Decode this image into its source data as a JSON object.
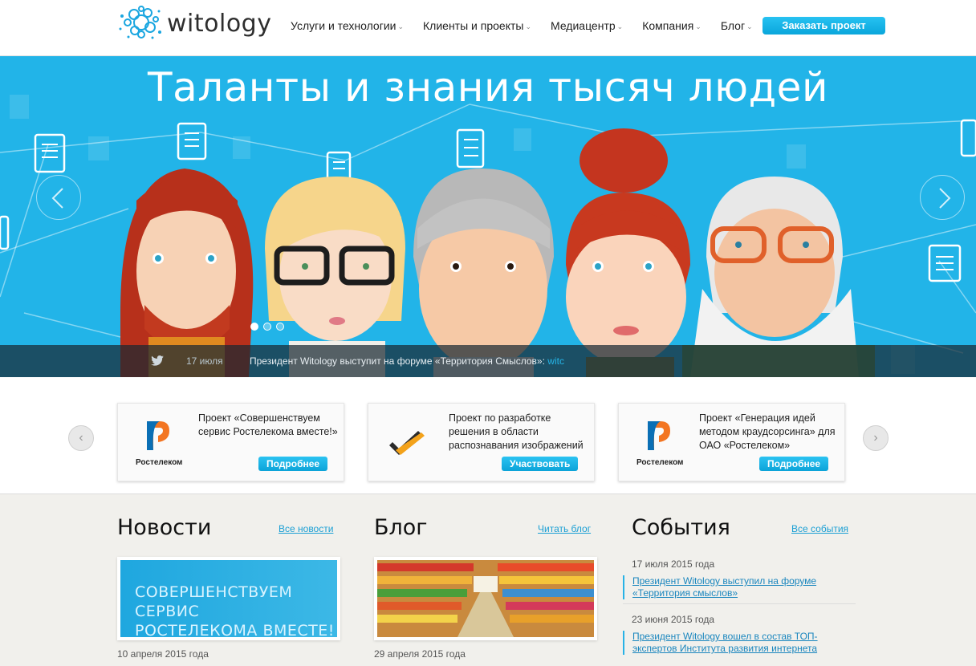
{
  "header": {
    "logo_text": "witology",
    "nav": [
      {
        "label": "Услуги и технологии"
      },
      {
        "label": "Клиенты и проекты"
      },
      {
        "label": "Медиацентр"
      },
      {
        "label": "Компания"
      },
      {
        "label": "Блог"
      }
    ],
    "order_button": "Заказать проект"
  },
  "hero": {
    "title": "Таланты и знания тысяч людей",
    "ticker_date": "17 июля",
    "ticker_text": "Президент Witology выступит на форуме «Территория Смыслов»:",
    "ticker_link": "witc",
    "slides": 3,
    "active_slide": 1
  },
  "projects": {
    "cards": [
      {
        "logo": "Ростелеком",
        "text": "Проект «Совершенствуем сервис Ростелекома вместе!»",
        "button": "Подробнее"
      },
      {
        "logo": "check-logo",
        "text": "Проект по разработке решения в области распознавания изображений",
        "button": "Участвовать"
      },
      {
        "logo": "Ростелеком",
        "text": "Проект «Генерация идей методом краудсорсинга» для ОАО «Ростелеком»",
        "button": "Подробнее"
      }
    ]
  },
  "news": {
    "title": "Новости",
    "link": "Все новости",
    "image_text_1": "СОВЕРШЕНСТВУЕМ СЕРВИС",
    "image_text_2": "РОСТЕЛЕКОМА ВМЕСТЕ!",
    "date": "10 апреля 2015 года"
  },
  "blog": {
    "title": "Блог",
    "link": "Читать блог",
    "date": "29 апреля 2015 года"
  },
  "events": {
    "title": "События",
    "link": "Все события",
    "items": [
      {
        "date": "17 июля 2015 года",
        "text": "Президент Witology выступил на форуме «Территория смыслов»"
      },
      {
        "date": "23 июня 2015 года",
        "text": "Президент Witology вошел в состав ТОП-экспертов Института развития интернета"
      }
    ]
  },
  "colors": {
    "accent": "#22b4e8",
    "button": "#0aa6db"
  }
}
